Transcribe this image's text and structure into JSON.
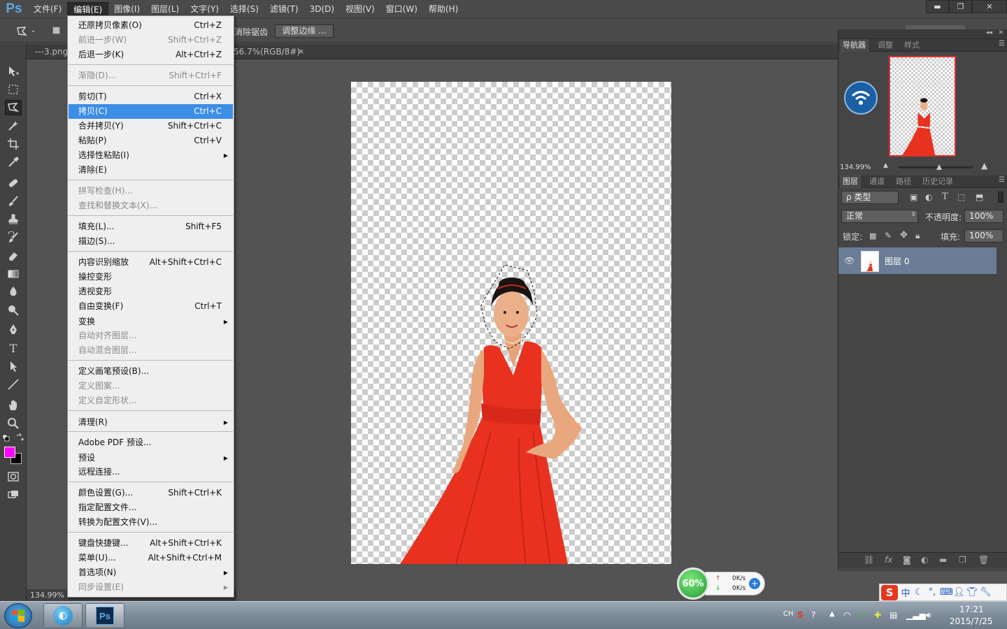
{
  "app": {
    "logo": "Ps"
  },
  "menubar": {
    "items": [
      "文件(F)",
      "编辑(E)",
      "图像(I)",
      "图层(L)",
      "文字(Y)",
      "选择(S)",
      "滤镜(T)",
      "3D(D)",
      "视图(V)",
      "窗口(W)",
      "帮助(H)"
    ],
    "active_index": 1
  },
  "window_controls": {
    "minimize": "▬",
    "restore": "❐",
    "close": "✕"
  },
  "options_bar": {
    "label": "消除锯齿",
    "refine_edge": "调整边缘 ..."
  },
  "doc_tabs": {
    "tab1": "---3.png",
    "tab2": "56.7%(RGB/8#)",
    "close": "×"
  },
  "status": {
    "zoom": "134.99%"
  },
  "edit_menu": {
    "items": [
      {
        "label": "还原拷贝像素(O)",
        "shortcut": "Ctrl+Z",
        "disabled": false
      },
      {
        "label": "前进一步(W)",
        "shortcut": "Shift+Ctrl+Z",
        "disabled": true
      },
      {
        "label": "后退一步(K)",
        "shortcut": "Alt+Ctrl+Z",
        "disabled": false
      },
      {
        "label": "渐隐(D)...",
        "shortcut": "Shift+Ctrl+F",
        "disabled": true
      },
      {
        "label": "剪切(T)",
        "shortcut": "Ctrl+X",
        "disabled": false
      },
      {
        "label": "拷贝(C)",
        "shortcut": "Ctrl+C",
        "disabled": false,
        "highlighted": true
      },
      {
        "label": "合并拷贝(Y)",
        "shortcut": "Shift+Ctrl+C",
        "disabled": false
      },
      {
        "label": "粘贴(P)",
        "shortcut": "Ctrl+V",
        "disabled": false
      },
      {
        "label": "选择性粘贴(I)",
        "shortcut": "",
        "disabled": false,
        "submenu": true
      },
      {
        "label": "清除(E)",
        "shortcut": "",
        "disabled": false
      },
      {
        "label": "拼写检查(H)...",
        "shortcut": "",
        "disabled": true
      },
      {
        "label": "查找和替换文本(X)...",
        "shortcut": "",
        "disabled": true
      },
      {
        "label": "填充(L)...",
        "shortcut": "Shift+F5",
        "disabled": false
      },
      {
        "label": "描边(S)...",
        "shortcut": "",
        "disabled": false
      },
      {
        "label": "内容识别缩放",
        "shortcut": "Alt+Shift+Ctrl+C",
        "disabled": false
      },
      {
        "label": "操控变形",
        "shortcut": "",
        "disabled": false
      },
      {
        "label": "透视变形",
        "shortcut": "",
        "disabled": false
      },
      {
        "label": "自由变换(F)",
        "shortcut": "Ctrl+T",
        "disabled": false
      },
      {
        "label": "变换",
        "shortcut": "",
        "disabled": false,
        "submenu": true
      },
      {
        "label": "自动对齐图层...",
        "shortcut": "",
        "disabled": true
      },
      {
        "label": "自动混合图层...",
        "shortcut": "",
        "disabled": true
      },
      {
        "label": "定义画笔预设(B)...",
        "shortcut": "",
        "disabled": false
      },
      {
        "label": "定义图案...",
        "shortcut": "",
        "disabled": true
      },
      {
        "label": "定义自定形状...",
        "shortcut": "",
        "disabled": true
      },
      {
        "label": "清理(R)",
        "shortcut": "",
        "disabled": false,
        "submenu": true
      },
      {
        "label": "Adobe PDF 预设...",
        "shortcut": "",
        "disabled": false
      },
      {
        "label": "预设",
        "shortcut": "",
        "disabled": false,
        "submenu": true
      },
      {
        "label": "远程连接...",
        "shortcut": "",
        "disabled": false
      },
      {
        "label": "颜色设置(G)...",
        "shortcut": "Shift+Ctrl+K",
        "disabled": false
      },
      {
        "label": "指定配置文件...",
        "shortcut": "",
        "disabled": false
      },
      {
        "label": "转换为配置文件(V)...",
        "shortcut": "",
        "disabled": false
      },
      {
        "label": "键盘快捷键...",
        "shortcut": "Alt+Shift+Ctrl+K",
        "disabled": false
      },
      {
        "label": "菜单(U)...",
        "shortcut": "Alt+Shift+Ctrl+M",
        "disabled": false
      },
      {
        "label": "首选项(N)",
        "shortcut": "",
        "disabled": false,
        "submenu": true
      },
      {
        "label": "同步设置(E)",
        "shortcut": "",
        "disabled": true,
        "submenu": true
      }
    ]
  },
  "navigator": {
    "tabs": [
      "导航器",
      "调整",
      "样式"
    ],
    "zoom": "134.99%"
  },
  "layers_panel": {
    "tabs": [
      "图层",
      "通道",
      "路径",
      "历史记录"
    ],
    "filter": "ρ 类型",
    "blend_mode": "正常",
    "opacity_label": "不透明度:",
    "opacity_value": "100%",
    "lock_label": "锁定:",
    "fill_label": "填充:",
    "fill_value": "100%",
    "layer_name": "图层 0"
  },
  "speed_widget": {
    "percent": "60%",
    "up": "0K/s",
    "down": "0K/s",
    "plus": "+"
  },
  "ime": {
    "logo": "S",
    "mode": "中"
  },
  "taskbar": {
    "ps_label": "Ps",
    "lang": "CH",
    "time": "17:21",
    "date": "2015/7/25"
  },
  "colors": {
    "foreground": "#ff00ff",
    "background": "#000000",
    "highlight": "#3c8ee6",
    "dress": "#e8321f"
  }
}
